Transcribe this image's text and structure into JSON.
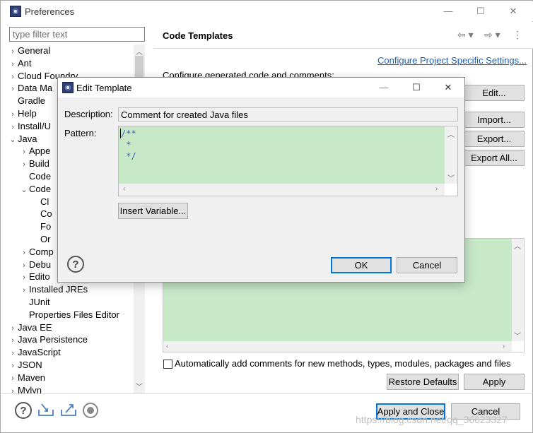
{
  "window": {
    "title": "Preferences",
    "minimize": "—",
    "maximize": "☐",
    "close": "✕"
  },
  "filter": {
    "placeholder": "type filter text",
    "value": ""
  },
  "tree": [
    {
      "label": "General",
      "twisty": "›",
      "indent": 0
    },
    {
      "label": "Ant",
      "twisty": "›",
      "indent": 0
    },
    {
      "label": "Cloud Foundry",
      "twisty": "›",
      "indent": 0
    },
    {
      "label": "Data Ma",
      "twisty": "›",
      "indent": 0
    },
    {
      "label": "Gradle",
      "twisty": "",
      "indent": 0
    },
    {
      "label": "Help",
      "twisty": "›",
      "indent": 0
    },
    {
      "label": "Install/U",
      "twisty": "›",
      "indent": 0
    },
    {
      "label": "Java",
      "twisty": "⌄",
      "indent": 0
    },
    {
      "label": "Appe",
      "twisty": "›",
      "indent": 1
    },
    {
      "label": "Build",
      "twisty": "›",
      "indent": 1
    },
    {
      "label": "Code",
      "twisty": "",
      "indent": 1
    },
    {
      "label": "Code",
      "twisty": "⌄",
      "indent": 1
    },
    {
      "label": "Cl",
      "twisty": "",
      "indent": 2
    },
    {
      "label": "Co",
      "twisty": "",
      "indent": 2
    },
    {
      "label": "Fo",
      "twisty": "",
      "indent": 2
    },
    {
      "label": "Or",
      "twisty": "",
      "indent": 2
    },
    {
      "label": "Comp",
      "twisty": "›",
      "indent": 1
    },
    {
      "label": "Debu",
      "twisty": "›",
      "indent": 1
    },
    {
      "label": "Edito",
      "twisty": "›",
      "indent": 1
    },
    {
      "label": "Installed JREs",
      "twisty": "›",
      "indent": 1
    },
    {
      "label": "JUnit",
      "twisty": "",
      "indent": 1
    },
    {
      "label": "Properties Files Editor",
      "twisty": "",
      "indent": 1
    },
    {
      "label": "Java EE",
      "twisty": "›",
      "indent": 0
    },
    {
      "label": "Java Persistence",
      "twisty": "›",
      "indent": 0
    },
    {
      "label": "JavaScript",
      "twisty": "›",
      "indent": 0
    },
    {
      "label": "JSON",
      "twisty": "›",
      "indent": 0
    },
    {
      "label": "Maven",
      "twisty": "›",
      "indent": 0
    },
    {
      "label": "Mylyn",
      "twisty": "›",
      "indent": 0
    }
  ],
  "page": {
    "title": "Code Templates",
    "back": "⇦ ▾",
    "forward": "⇨ ▾",
    "menu": "⋮",
    "configure_link": "Configure Project Specific Settings...",
    "configure_text": "Configure generated code and comments:",
    "buttons": {
      "edit": "Edit...",
      "import": "Import...",
      "export": "Export...",
      "export_all": "Export All..."
    },
    "checkbox_label": "Automatically add comments for new methods, types, modules, packages and files",
    "restore_defaults": "Restore Defaults",
    "apply": "Apply"
  },
  "footer": {
    "apply_close": "Apply and Close",
    "cancel": "Cancel"
  },
  "dialog": {
    "title": "Edit Template",
    "description_label": "Description:",
    "description_value": "Comment for created Java files",
    "pattern_label": "Pattern:",
    "pattern_lines": [
      "/**",
      " *",
      " */"
    ],
    "insert_variable": "Insert Variable...",
    "ok": "OK",
    "cancel": "Cancel",
    "minimize": "—",
    "maximize": "☐",
    "close": "✕"
  },
  "watermark": "https://blog.csdn.net/qq_36623327",
  "colors": {
    "accent": "#0078d7",
    "editor_bg": "#c7e9c8",
    "link": "#1a5fb4"
  }
}
